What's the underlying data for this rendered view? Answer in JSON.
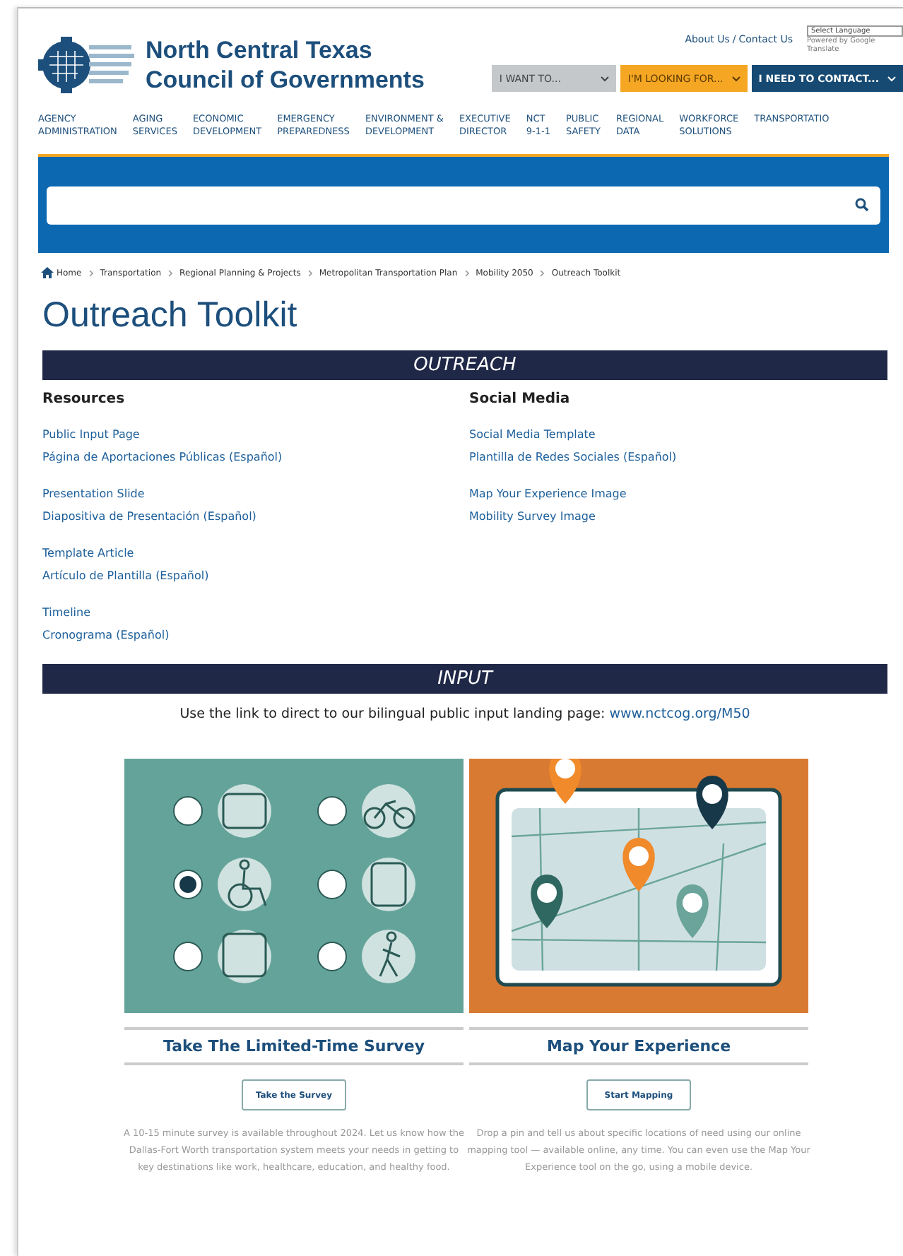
{
  "header": {
    "org_name": [
      "North Central Texas",
      "Council of Governments"
    ],
    "top_links": [
      "About Us",
      "/",
      "Contact Us"
    ],
    "language_select": {
      "value": "Select Language",
      "powered_by": "Powered by Google Translate"
    },
    "menus": [
      {
        "label": "I WANT TO...",
        "kind": "grey"
      },
      {
        "label": "I'M LOOKING FOR...",
        "kind": "gold"
      },
      {
        "label": "I NEED TO CONTACT...",
        "kind": "navy"
      }
    ]
  },
  "nav": [
    [
      "AGENCY",
      "ADMINISTRATION"
    ],
    [
      "AGING",
      "SERVICES"
    ],
    [
      "ECONOMIC",
      "DEVELOPMENT"
    ],
    [
      "EMERGENCY",
      "PREPAREDNESS"
    ],
    [
      "ENVIRONMENT &",
      "DEVELOPMENT"
    ],
    [
      "EXECUTIVE",
      "DIRECTOR"
    ],
    [
      "NCT",
      "9-1-1"
    ],
    [
      "PUBLIC",
      "SAFETY"
    ],
    [
      "REGIONAL",
      "DATA"
    ],
    [
      "WORKFORCE",
      "SOLUTIONS"
    ],
    [
      "TRANSPORTATIO"
    ]
  ],
  "breadcrumb": [
    "Home",
    "Transportation",
    "Regional Planning & Projects",
    "Metropolitan Transportation Plan",
    "Mobility 2050",
    "Outreach Toolkit"
  ],
  "page_title": "Outreach Toolkit",
  "outreach": {
    "heading": "OUTREACH",
    "columns": [
      {
        "title": "Resources",
        "groups": [
          [
            "Public Input Page",
            "Página de Aportaciones Públicas (Español)"
          ],
          [
            "Presentation Slide",
            "Diapositiva de Presentación (Español)"
          ],
          [
            "Template Article",
            "Artículo de Plantilla (Español)"
          ],
          [
            "Timeline",
            "Cronograma (Español)"
          ]
        ]
      },
      {
        "title": "Social Media",
        "groups": [
          [
            "Social Media Template",
            "Plantilla de Redes Sociales (Español)"
          ],
          [
            "Map Your Experience Image",
            "Mobility Survey Image"
          ]
        ]
      }
    ]
  },
  "input": {
    "heading": "INPUT",
    "intro": "Use the link to direct to our bilingual public input landing page:",
    "link": "www.nctcog.org/M50",
    "cards": [
      {
        "kind": "survey",
        "title": "Take The Limited-Time Survey",
        "button": "Take the Survey",
        "text": "A 10-15 minute survey is available throughout 2024. Let us know how the Dallas-Fort Worth transportation system meets your needs in getting to key destinations like work, healthcare, education, and healthy food."
      },
      {
        "kind": "map",
        "title": "Map Your Experience",
        "button": "Start Mapping",
        "text": "Drop a pin and tell us about specific locations of need using our online mapping tool — available online, any time. You can even use the Map Your Experience tool on the go, using a mobile device."
      }
    ]
  }
}
